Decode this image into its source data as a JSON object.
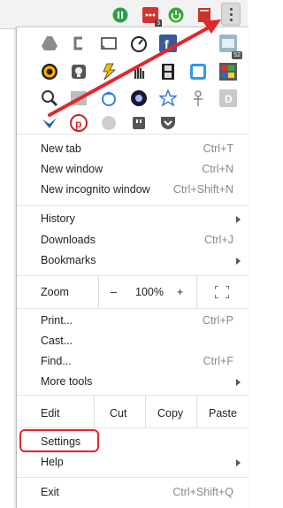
{
  "toolbar": {
    "extensions": [
      {
        "icon": "pause-ext-icon",
        "color": "#2aa14a"
      },
      {
        "icon": "grid-ext-icon",
        "color": "#d83131",
        "badge": "3"
      },
      {
        "icon": "power-ext-icon",
        "color": "#39a93a"
      },
      {
        "icon": "book-ext-icon",
        "color": "#c8342c"
      }
    ],
    "menu_icon": "more-vert-icon"
  },
  "menu": {
    "apps": [
      {
        "icon": "drive-icon"
      },
      {
        "icon": "bracket-icon"
      },
      {
        "icon": "cast-icon"
      },
      {
        "icon": "speed-icon"
      },
      {
        "icon": "facebook-icon"
      },
      {
        "icon": "blank-icon"
      },
      {
        "icon": "gallery-icon",
        "badge": "52"
      },
      {
        "icon": "color-wheel-icon"
      },
      {
        "icon": "lightbulb-icon"
      },
      {
        "icon": "bolt-icon"
      },
      {
        "icon": "hand-icon"
      },
      {
        "icon": "film-icon"
      },
      {
        "icon": "frame-icon"
      },
      {
        "icon": "flag-icon"
      },
      {
        "icon": "magnifier-icon"
      },
      {
        "icon": "image-icon"
      },
      {
        "icon": "drop-icon"
      },
      {
        "icon": "planet-icon"
      },
      {
        "icon": "star-icon"
      },
      {
        "icon": "ankh-icon"
      },
      {
        "icon": "d-letter-icon"
      },
      {
        "icon": "v-bird-icon"
      },
      {
        "icon": "pinterest-icon"
      },
      {
        "icon": "circle-icon"
      },
      {
        "icon": "plug-icon"
      },
      {
        "icon": "pocket-icon"
      }
    ],
    "new_tab": {
      "label": "New tab",
      "shortcut": "Ctrl+T"
    },
    "new_window": {
      "label": "New window",
      "shortcut": "Ctrl+N"
    },
    "new_incognito": {
      "label": "New incognito window",
      "shortcut": "Ctrl+Shift+N"
    },
    "history": {
      "label": "History"
    },
    "downloads": {
      "label": "Downloads",
      "shortcut": "Ctrl+J"
    },
    "bookmarks": {
      "label": "Bookmarks"
    },
    "zoom": {
      "label": "Zoom",
      "minus": "–",
      "value": "100%",
      "plus": "+"
    },
    "print": {
      "label": "Print...",
      "shortcut": "Ctrl+P"
    },
    "cast": {
      "label": "Cast..."
    },
    "find": {
      "label": "Find...",
      "shortcut": "Ctrl+F"
    },
    "more_tools": {
      "label": "More tools"
    },
    "edit": {
      "label": "Edit",
      "cut": "Cut",
      "copy": "Copy",
      "paste": "Paste"
    },
    "settings": {
      "label": "Settings"
    },
    "help": {
      "label": "Help"
    },
    "exit": {
      "label": "Exit",
      "shortcut": "Ctrl+Shift+Q"
    }
  },
  "colors": {
    "highlight": "#e3262c",
    "arrow": "#e3262c"
  }
}
